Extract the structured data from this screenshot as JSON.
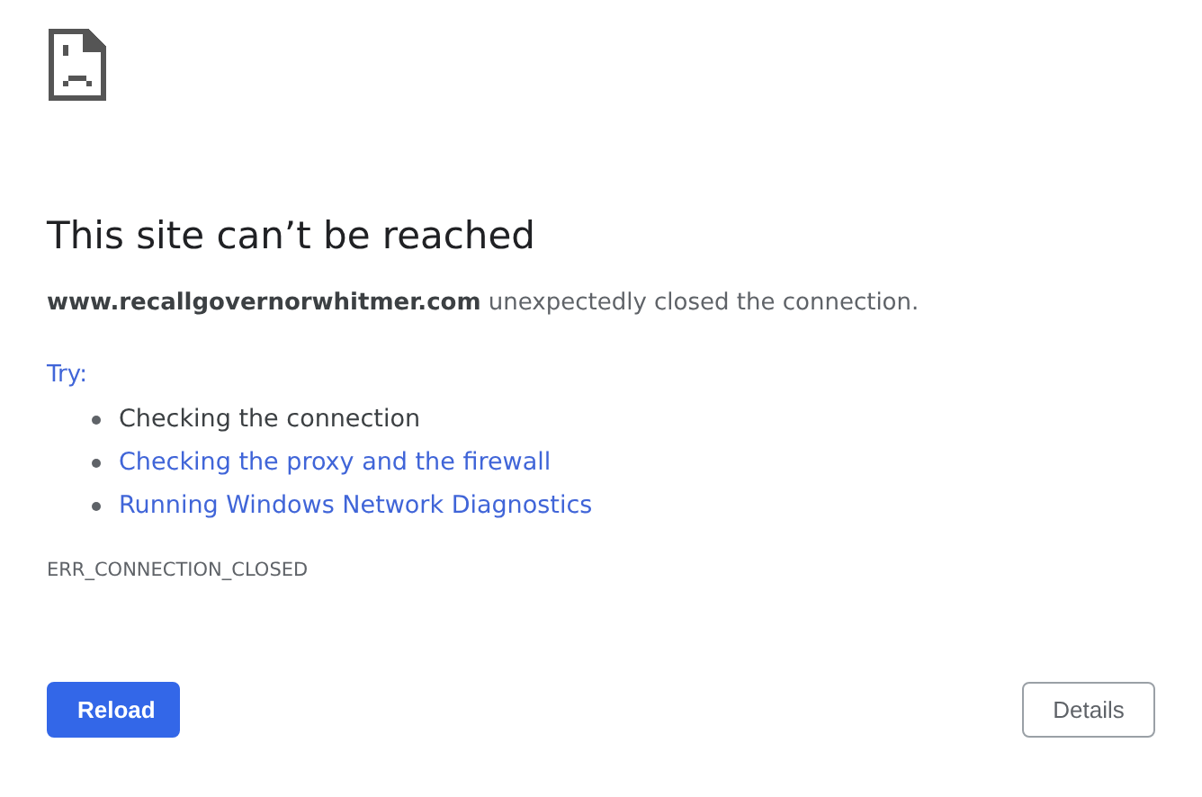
{
  "heading": "This site can’t be reached",
  "message": "**www.recallgovernorwhitmer.com** unexpectedly closed the connection.",
  "try_label": "Try:",
  "suggestions": [
    {
      "kind": "text",
      "label": "Checking the connection"
    },
    {
      "kind": "link",
      "label": "Checking the proxy and the firewall"
    },
    {
      "kind": "link",
      "label": "Running Windows Network Diagnostics"
    }
  ],
  "error_code": "ERR_CONNECTION_CLOSED",
  "buttons": [
    {
      "kind": "primary",
      "label": "Reload"
    },
    {
      "kind": "secondary",
      "label": "Details"
    }
  ]
}
